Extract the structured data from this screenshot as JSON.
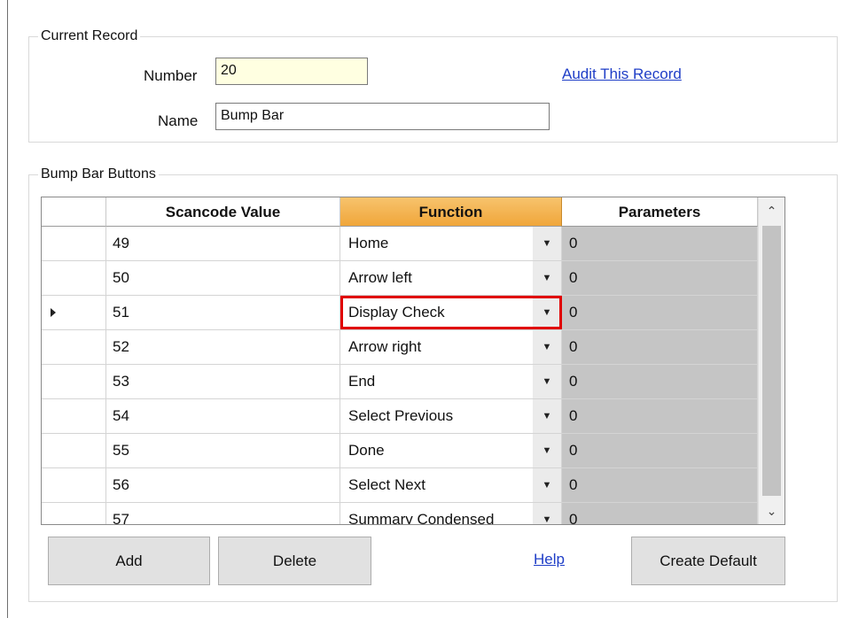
{
  "current_record": {
    "legend": "Current Record",
    "number_label": "Number",
    "number_value": "20",
    "name_label": "Name",
    "name_value": "Bump Bar",
    "audit_link": "Audit This Record"
  },
  "bump_bar": {
    "legend": "Bump Bar Buttons",
    "columns": [
      "Scancode Value",
      "Function",
      "Parameters"
    ],
    "rows": [
      {
        "scancode": "49",
        "function": "Home",
        "parameters": "0"
      },
      {
        "scancode": "50",
        "function": "Arrow left",
        "parameters": "0"
      },
      {
        "scancode": "51",
        "function": "Display Check",
        "parameters": "0"
      },
      {
        "scancode": "52",
        "function": "Arrow right",
        "parameters": "0"
      },
      {
        "scancode": "53",
        "function": "End",
        "parameters": "0"
      },
      {
        "scancode": "54",
        "function": "Select Previous",
        "parameters": "0"
      },
      {
        "scancode": "55",
        "function": "Done",
        "parameters": "0"
      },
      {
        "scancode": "56",
        "function": "Select Next",
        "parameters": "0"
      },
      {
        "scancode": "57",
        "function": "Summary Condensed",
        "parameters": "0"
      }
    ],
    "current_row_index": 2
  },
  "buttons": {
    "add": "Add",
    "delete": "Delete",
    "help": "Help",
    "create_default": "Create Default"
  },
  "colors": {
    "highlight_border": "#e00000",
    "function_header": "#f0a63a",
    "link": "#1f3ec7",
    "number_field_bg": "#ffffe1"
  },
  "icons": {
    "dropdown": "chevron-down-icon",
    "row_indicator": "current-row-arrow-icon",
    "scroll_up": "scroll-up-icon",
    "scroll_down": "scroll-down-icon"
  }
}
